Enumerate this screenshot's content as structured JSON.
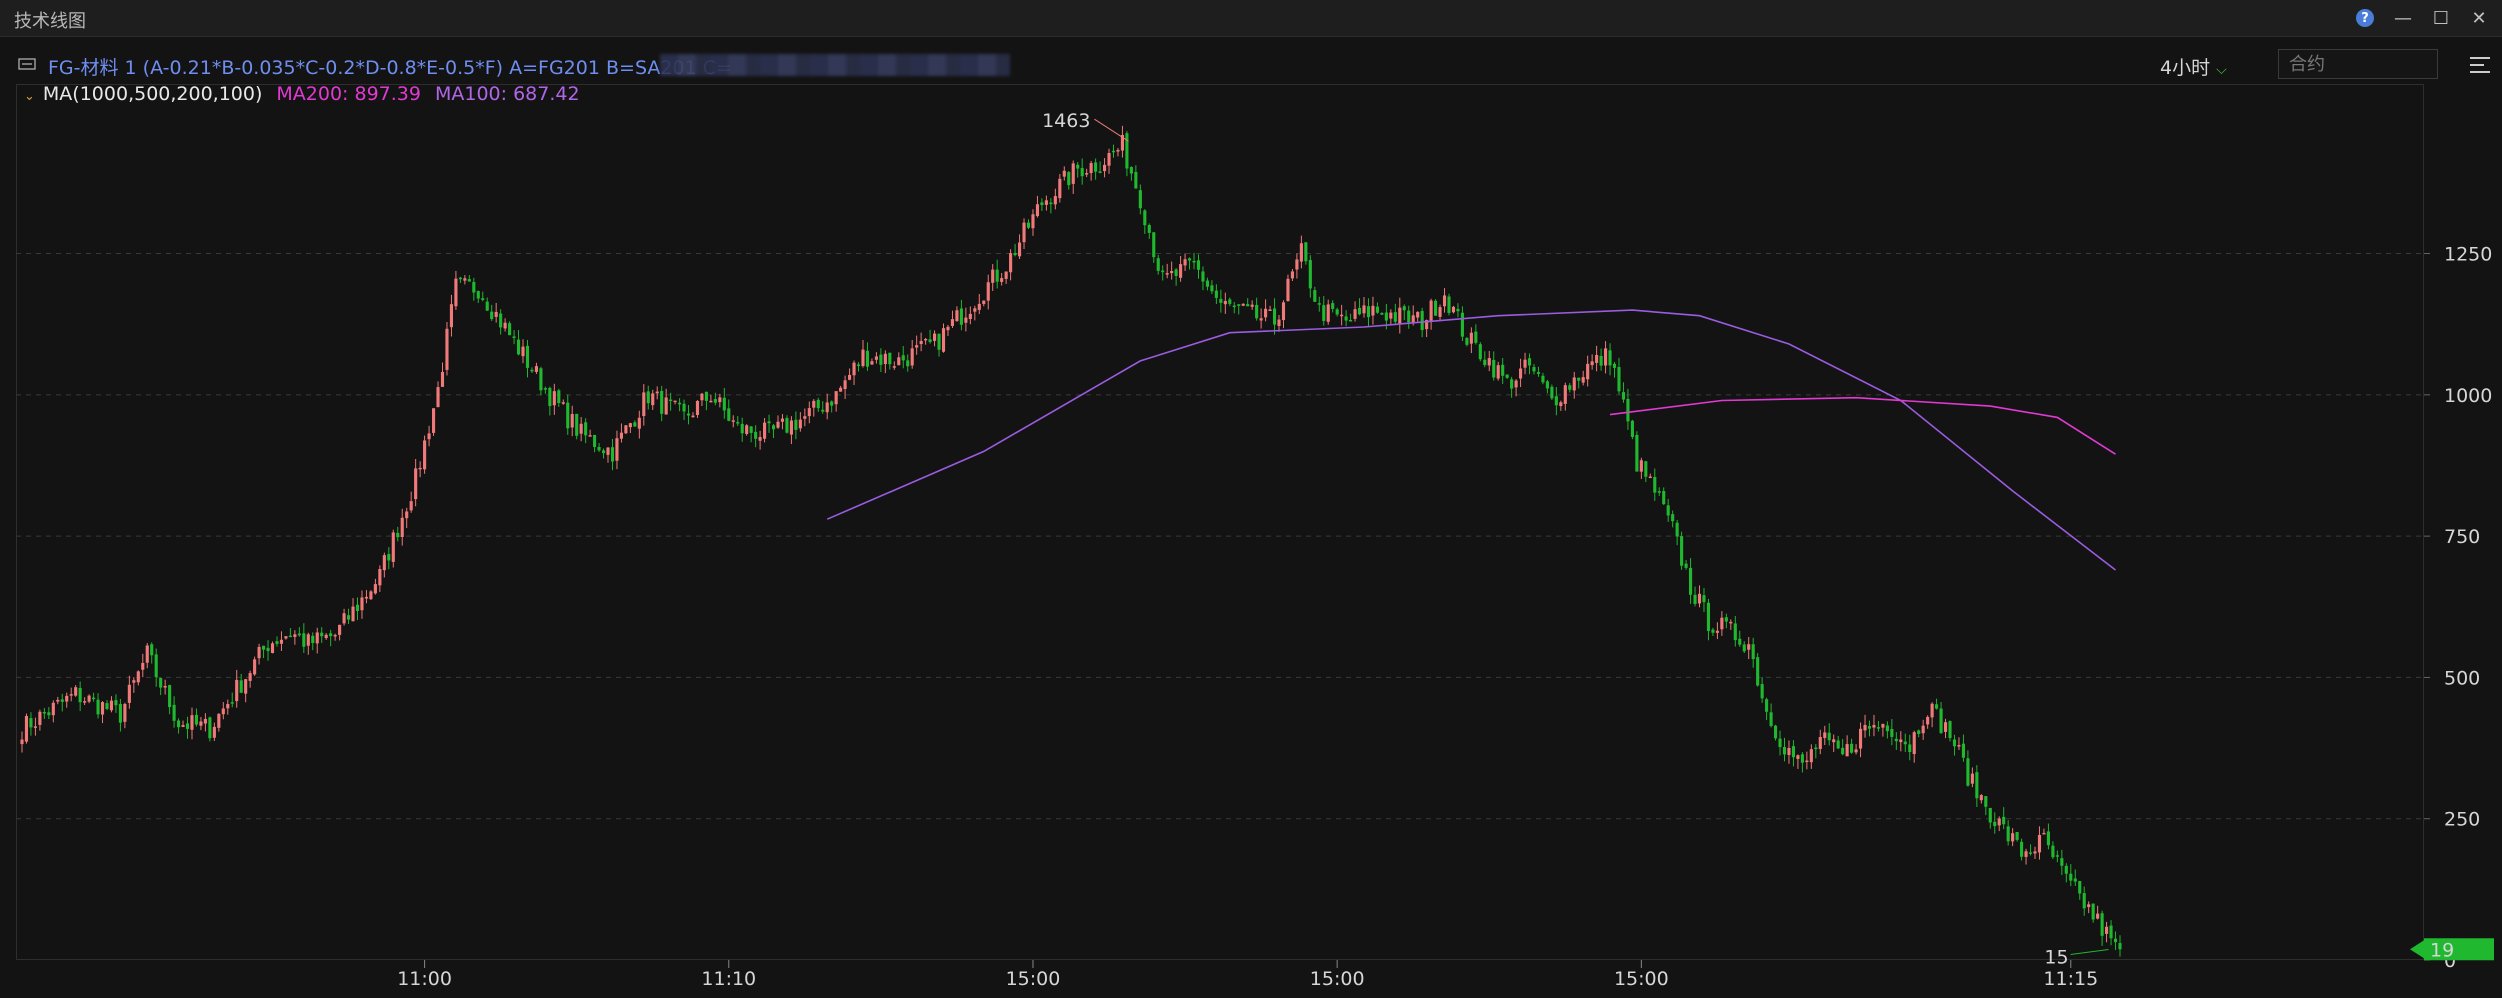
{
  "window": {
    "title": "技术线图"
  },
  "header": {
    "formula": "FG-材料 1 (A-0.21*B-0.035*C-0.2*D-0.8*E-0.5*F) A=FG201 B=SA201 C=",
    "period": "4小时",
    "contract_placeholder": "合约"
  },
  "ma_legend": {
    "label": "MA(1000,500,200,100)",
    "ma200": "MA200: 897.39",
    "ma100": "MA100: 687.42"
  },
  "colors": {
    "up": "#f07a7a",
    "down": "#1fb82f",
    "ma200": "#e03ad2",
    "ma100": "#9a5ce0",
    "background": "#131313"
  },
  "chart_data": {
    "type": "candlestick",
    "y_ticks": [
      "1250",
      "1000",
      "750",
      "500",
      "250",
      "0"
    ],
    "ylim": [
      0,
      1550
    ],
    "x_ticks": [
      "11:00",
      "11:10",
      "15:00",
      "15:00",
      "15:00",
      "11:15"
    ],
    "max_label": "1463",
    "min_label": "15",
    "last_price": "19",
    "anchors": [
      [
        0,
        410
      ],
      [
        12,
        470
      ],
      [
        22,
        435
      ],
      [
        28,
        540
      ],
      [
        35,
        420
      ],
      [
        42,
        410
      ],
      [
        55,
        560
      ],
      [
        60,
        580
      ],
      [
        64,
        560
      ],
      [
        70,
        575
      ],
      [
        80,
        680
      ],
      [
        88,
        850
      ],
      [
        93,
        1010
      ],
      [
        97,
        1190
      ],
      [
        102,
        1190
      ],
      [
        107,
        1130
      ],
      [
        112,
        1070
      ],
      [
        118,
        1000
      ],
      [
        125,
        930
      ],
      [
        132,
        900
      ],
      [
        140,
        1000
      ],
      [
        148,
        960
      ],
      [
        154,
        1000
      ],
      [
        160,
        940
      ],
      [
        167,
        930
      ],
      [
        175,
        960
      ],
      [
        182,
        1000
      ],
      [
        188,
        1070
      ],
      [
        196,
        1060
      ],
      [
        204,
        1090
      ],
      [
        212,
        1160
      ],
      [
        220,
        1230
      ],
      [
        228,
        1340
      ],
      [
        236,
        1400
      ],
      [
        241,
        1410
      ],
      [
        246,
        1440
      ],
      [
        250,
        1350
      ],
      [
        255,
        1200
      ],
      [
        262,
        1230
      ],
      [
        268,
        1160
      ],
      [
        275,
        1140
      ],
      [
        280,
        1130
      ],
      [
        286,
        1250
      ],
      [
        290,
        1150
      ],
      [
        296,
        1130
      ],
      [
        302,
        1150
      ],
      [
        307,
        1140
      ],
      [
        313,
        1130
      ],
      [
        318,
        1180
      ],
      [
        323,
        1100
      ],
      [
        328,
        1060
      ],
      [
        332,
        1020
      ],
      [
        337,
        1050
      ],
      [
        342,
        990
      ],
      [
        346,
        1020
      ],
      [
        350,
        1050
      ],
      [
        355,
        1070
      ],
      [
        358,
        980
      ],
      [
        361,
        880
      ],
      [
        365,
        830
      ],
      [
        369,
        760
      ],
      [
        373,
        660
      ],
      [
        377,
        600
      ],
      [
        382,
        580
      ],
      [
        386,
        560
      ],
      [
        390,
        440
      ],
      [
        394,
        380
      ],
      [
        398,
        340
      ],
      [
        402,
        390
      ],
      [
        407,
        360
      ],
      [
        412,
        410
      ],
      [
        417,
        420
      ],
      [
        422,
        380
      ],
      [
        426,
        450
      ],
      [
        431,
        400
      ],
      [
        436,
        310
      ],
      [
        441,
        250
      ],
      [
        447,
        190
      ],
      [
        452,
        210
      ],
      [
        457,
        140
      ],
      [
        462,
        90
      ],
      [
        466,
        45
      ],
      [
        468,
        19
      ]
    ],
    "ma200": [
      [
        355,
        965
      ],
      [
        380,
        990
      ],
      [
        410,
        995
      ],
      [
        440,
        980
      ],
      [
        455,
        960
      ],
      [
        468,
        895
      ]
    ],
    "ma100": [
      [
        180,
        780
      ],
      [
        215,
        900
      ],
      [
        250,
        1060
      ],
      [
        270,
        1110
      ],
      [
        300,
        1120
      ],
      [
        330,
        1140
      ],
      [
        360,
        1150
      ],
      [
        375,
        1140
      ],
      [
        395,
        1090
      ],
      [
        420,
        990
      ],
      [
        445,
        830
      ],
      [
        468,
        690
      ]
    ]
  }
}
